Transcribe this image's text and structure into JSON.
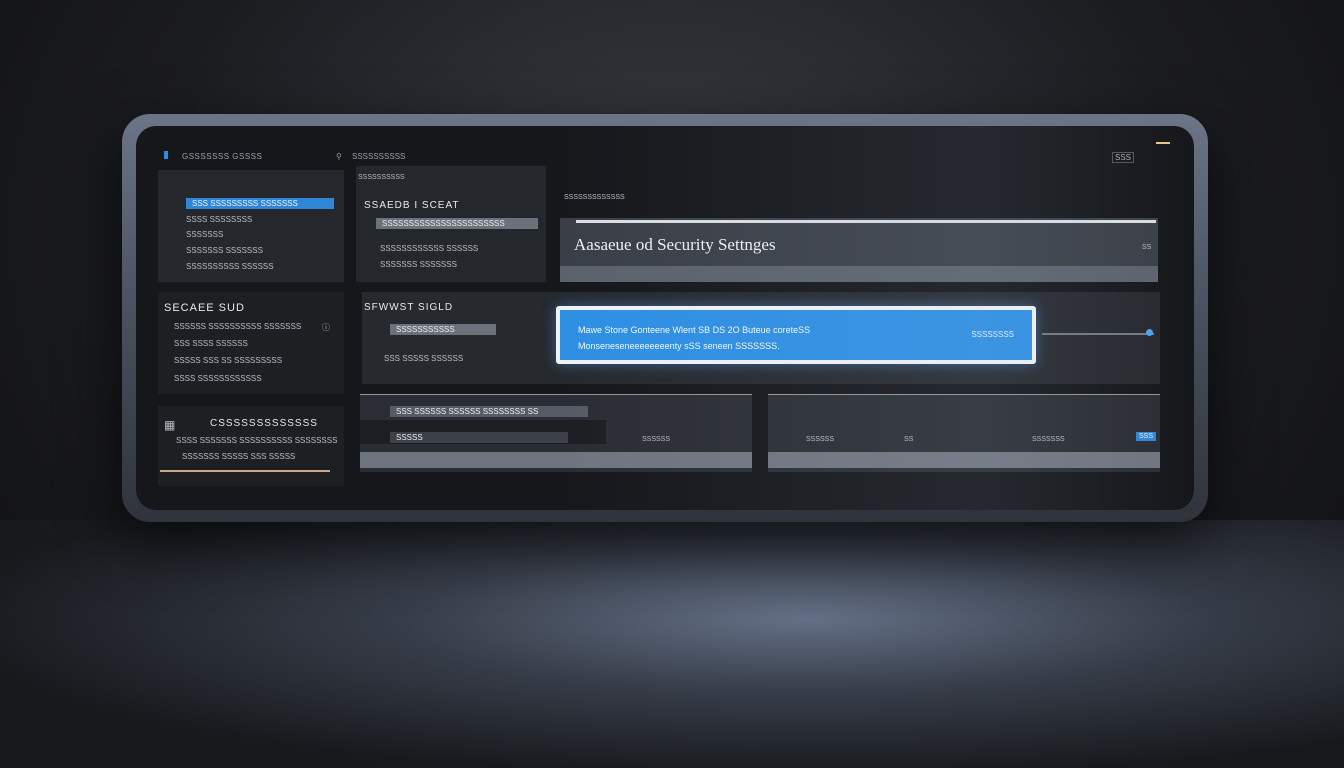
{
  "topbar": {
    "app_name": "GSSSSSSS GSSSS",
    "breadcrumb": "SSSSSSSSSS",
    "version_badge": "SSS"
  },
  "left_top": {
    "selected_item": "SSS SSSSSSSSS SSSSSSS",
    "items": [
      "SSSS SSSSSSSS",
      "SSSSSSS",
      "SSSSSSS SSSSSSS",
      "SSSSSSSSSS SSSSSS"
    ]
  },
  "left_mid": {
    "heading": "SECAEE SUD",
    "items": [
      "SSSSSS SSSSSSSSSS SSSSSSS",
      "SSS SSSS SSSSSS",
      "SSSSS SSS SS SSSSSSSSS",
      "SSSS SSSSSSSSSSSS"
    ]
  },
  "left_bottom": {
    "heading": "CSSSSSSSSSSSSS",
    "items": [
      "SSSS SSSSSSS SSSSSSSSSS SSSSSSSS",
      "SSSSSSS SSSSS SSS SSSSS"
    ]
  },
  "mid_top": {
    "label": "SSSSSSSSSS",
    "heading": "SSAEDB I SCEAT",
    "field": "SSSSSSSSSSSSSSSSSSSSSSS",
    "items": [
      "SSSSSSSSSSSS SSSSSS",
      "SSSSSSS SSSSSSS"
    ]
  },
  "mid_mid": {
    "heading": "SFWWST SIGLD",
    "field": "SSSSSSSSSSS",
    "note": "SSS SSSSS SSSSSS"
  },
  "hero": {
    "label": "SSSSSSSSSSSSS",
    "title": "Aasaeue od Security Settnges",
    "badge": "SS"
  },
  "alert": {
    "line1": "Mawe Stone Gonteene Wlent SB DS 2O Buteue coreteSS",
    "line2": "Monseneseneeeeeeeenty sSS seneen SSSSSSS.",
    "action": "SSSSSSSS"
  },
  "bottom_left": {
    "toolbar_text": "SSS SSSSSS SSSSSS SSSSSSSS SS",
    "sub": "SSSSS",
    "right_label": "SSSSSS"
  },
  "bottom_right": {
    "label1": "SSSSSS",
    "label2": "SS",
    "label3": "SSSSSSS",
    "chip": "SSS"
  }
}
